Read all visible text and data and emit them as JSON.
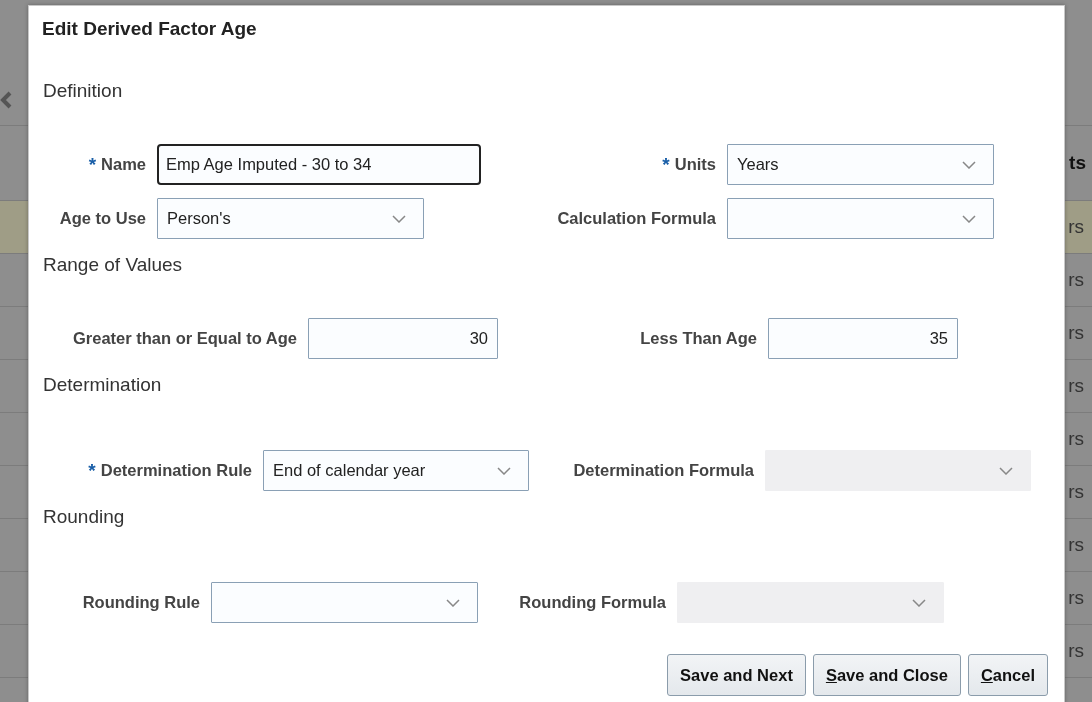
{
  "background": {
    "column_header": "ts",
    "rows": [
      {
        "text": "rs",
        "selected": true
      },
      {
        "text": "rs",
        "selected": false
      },
      {
        "text": "rs",
        "selected": false
      },
      {
        "text": "rs",
        "selected": false
      },
      {
        "text": "rs",
        "selected": false
      },
      {
        "text": "rs",
        "selected": false
      },
      {
        "text": "rs",
        "selected": false
      },
      {
        "text": "rs",
        "selected": false
      },
      {
        "text": "rs",
        "selected": false
      }
    ]
  },
  "dialog": {
    "title": "Edit Derived Factor Age",
    "sections": [
      {
        "heading": "Definition",
        "rows": [
          [
            {
              "required_mark": "*",
              "label": "Name",
              "kind": "text",
              "value": "Emp Age Imputed - 30 to 34",
              "focused": true,
              "disabled": false
            },
            {
              "required_mark": "*",
              "label": "Units",
              "kind": "select",
              "value": "Years",
              "focused": false,
              "disabled": false
            }
          ],
          [
            {
              "label": "Age to Use",
              "kind": "select",
              "value": "Person's",
              "focused": false,
              "disabled": false
            },
            {
              "label": "Calculation Formula",
              "kind": "select",
              "focused": false,
              "disabled": false
            }
          ]
        ]
      },
      {
        "heading": "Range of Values",
        "rows": [
          [
            {
              "label": "Greater than or Equal to Age",
              "kind": "number",
              "value": "30",
              "focused": false,
              "disabled": false
            },
            {
              "label": "Less Than Age",
              "kind": "number",
              "value": "35",
              "focused": false,
              "disabled": false
            }
          ]
        ]
      },
      {
        "heading": "Determination",
        "rows": [
          [
            {
              "required_mark": "*",
              "label": "Determination Rule",
              "kind": "select",
              "value": "End of calendar year",
              "focused": false,
              "disabled": false
            },
            {
              "label": "Determination Formula",
              "kind": "select",
              "focused": false,
              "disabled": true
            }
          ]
        ]
      },
      {
        "heading": "Rounding",
        "rows": [
          [
            {
              "label": "Rounding Rule",
              "kind": "select",
              "focused": false,
              "disabled": false
            },
            {
              "label": "Rounding Formula",
              "kind": "select",
              "focused": false,
              "disabled": true
            }
          ]
        ]
      }
    ],
    "buttons": [
      {
        "label": "Save and Next",
        "mnemonic": false
      },
      {
        "label": "Save and Close",
        "mnemonic": true
      },
      {
        "label": "Cancel",
        "mnemonic": true
      }
    ]
  }
}
